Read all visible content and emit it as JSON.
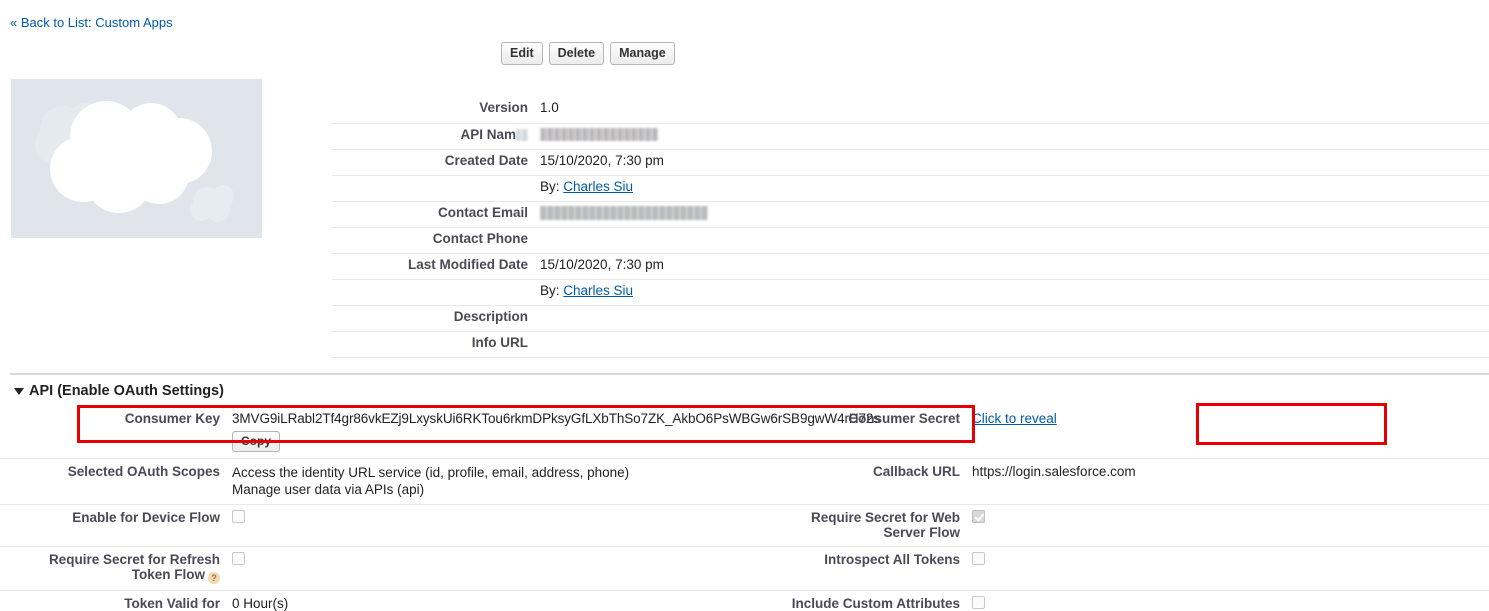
{
  "nav": {
    "back_link": "« Back to List: Custom Apps"
  },
  "toolbar": {
    "edit_label": "Edit",
    "delete_label": "Delete",
    "manage_label": "Manage"
  },
  "logo": {
    "alt": "cloud-logo",
    "background_color": "#dfe5ea"
  },
  "detail": {
    "rows": [
      {
        "label": "Version",
        "value": "1.0",
        "type": "text"
      },
      {
        "label": "API Nam",
        "value": "",
        "type": "redacted-api"
      },
      {
        "label": "Created Date",
        "value": "15/10/2020, 7:30 pm",
        "type": "text"
      },
      {
        "label": "",
        "value": "By: Charles Siu",
        "type": "by",
        "by_prefix": "By:",
        "by_user": "Charles Siu"
      },
      {
        "label": "Contact Email",
        "value": "",
        "type": "redacted-email"
      },
      {
        "label": "Contact Phone",
        "value": "",
        "type": "text"
      },
      {
        "label": "Last Modified Date",
        "value": "15/10/2020, 7:30 pm",
        "type": "text"
      },
      {
        "label": "",
        "value": "By: Charles Siu",
        "type": "by",
        "by_prefix": "By:",
        "by_user": "Charles Siu"
      },
      {
        "label": "Description",
        "value": "",
        "type": "text"
      },
      {
        "label": "Info URL",
        "value": "",
        "type": "text"
      }
    ]
  },
  "api_section": {
    "title": "API (Enable OAuth Settings)",
    "consumer_key_label": "Consumer Key",
    "consumer_key_value": "3MVG9iLRabl2Tf4gr86vkEZj9LxyskUi6RKTou6rkmDPksyGfLXbThSo7ZK_AkbO6PsWBGw6rSB9gwW4rH72s",
    "copy_label": "Copy",
    "consumer_secret_label": "Consumer Secret",
    "consumer_secret_value": "Click to reveal",
    "scopes_label": "Selected OAuth Scopes",
    "scopes": [
      "Access the identity URL service (id, profile, email, address, phone)",
      "Manage user data via APIs (api)"
    ],
    "callback_url_label": "Callback URL",
    "callback_url_value": "https://login.salesforce.com",
    "device_flow_label": "Enable for Device Flow",
    "device_flow_checked": false,
    "web_server_flow_label_line1": "Require Secret for Web",
    "web_server_flow_label_line2": "Server Flow",
    "web_server_flow_checked": true,
    "refresh_token_label_line1": "Require Secret for Refresh",
    "refresh_token_label_line2": "Token Flow",
    "refresh_token_checked": false,
    "refresh_token_help": "?",
    "introspect_label": "Introspect All Tokens",
    "introspect_checked": false,
    "token_valid_label": "Token Valid for",
    "token_valid_value": "0 Hour(s)",
    "custom_attributes_label": "Include Custom Attributes",
    "custom_attributes_checked": false
  },
  "highlights": {
    "color": "#e80000",
    "consumer_key_box": "consumer-key-highlight",
    "consumer_secret_box": "consumer-secret-highlight"
  }
}
